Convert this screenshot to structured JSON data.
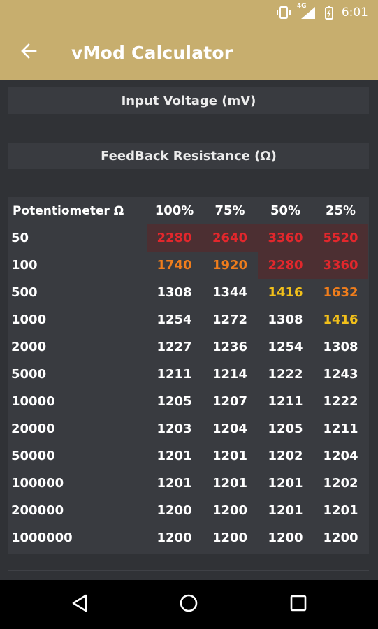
{
  "status_bar": {
    "time": "6:01",
    "network": "4G",
    "icons": [
      "vibrate-icon",
      "signal-icon",
      "battery-charging-icon"
    ]
  },
  "toolbar": {
    "title": "vMod Calculator",
    "back_icon": "arrow-back-icon"
  },
  "fields": {
    "input_voltage": "Input Voltage (mV)",
    "feedback_resistance": "FeedBack Resistance (Ω)"
  },
  "table": {
    "headers": [
      "Potentiometer Ω",
      "100%",
      "75%",
      "50%",
      "25%"
    ],
    "rows": [
      {
        "pot": "50",
        "values": [
          "2280",
          "2640",
          "3360",
          "5520"
        ]
      },
      {
        "pot": "100",
        "values": [
          "1740",
          "1920",
          "2280",
          "3360"
        ]
      },
      {
        "pot": "500",
        "values": [
          "1308",
          "1344",
          "1416",
          "1632"
        ]
      },
      {
        "pot": "1000",
        "values": [
          "1254",
          "1272",
          "1308",
          "1416"
        ]
      },
      {
        "pot": "2000",
        "values": [
          "1227",
          "1236",
          "1254",
          "1308"
        ]
      },
      {
        "pot": "5000",
        "values": [
          "1211",
          "1214",
          "1222",
          "1243"
        ]
      },
      {
        "pot": "10000",
        "values": [
          "1205",
          "1207",
          "1211",
          "1222"
        ]
      },
      {
        "pot": "20000",
        "values": [
          "1203",
          "1204",
          "1205",
          "1211"
        ]
      },
      {
        "pot": "50000",
        "values": [
          "1201",
          "1201",
          "1202",
          "1204"
        ]
      },
      {
        "pot": "100000",
        "values": [
          "1201",
          "1201",
          "1201",
          "1202"
        ]
      },
      {
        "pot": "200000",
        "values": [
          "1200",
          "1200",
          "1201",
          "1201"
        ]
      },
      {
        "pot": "1000000",
        "values": [
          "1200",
          "1200",
          "1200",
          "1200"
        ]
      }
    ]
  },
  "colors": {
    "appbar": "#c7ae6e",
    "background": "#303236",
    "danger": "#e2272c",
    "warning": "#ef7d1c",
    "caution": "#f2c01a"
  },
  "nav_bar": {
    "icons": [
      "back-triangle-icon",
      "home-circle-icon",
      "recents-square-icon"
    ]
  }
}
